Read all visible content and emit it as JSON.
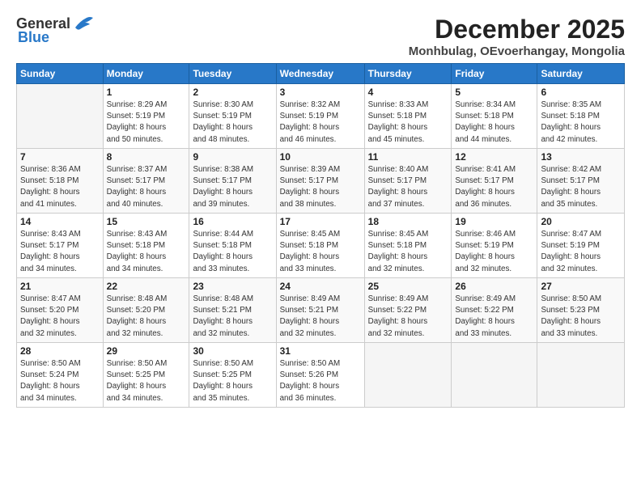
{
  "logo": {
    "general": "General",
    "blue": "Blue"
  },
  "title": {
    "month": "December 2025",
    "location": "Monhbulag, OEvoerhangay, Mongolia"
  },
  "header_days": [
    "Sunday",
    "Monday",
    "Tuesday",
    "Wednesday",
    "Thursday",
    "Friday",
    "Saturday"
  ],
  "weeks": [
    [
      {
        "day": "",
        "info": ""
      },
      {
        "day": "1",
        "info": "Sunrise: 8:29 AM\nSunset: 5:19 PM\nDaylight: 8 hours\nand 50 minutes."
      },
      {
        "day": "2",
        "info": "Sunrise: 8:30 AM\nSunset: 5:19 PM\nDaylight: 8 hours\nand 48 minutes."
      },
      {
        "day": "3",
        "info": "Sunrise: 8:32 AM\nSunset: 5:19 PM\nDaylight: 8 hours\nand 46 minutes."
      },
      {
        "day": "4",
        "info": "Sunrise: 8:33 AM\nSunset: 5:18 PM\nDaylight: 8 hours\nand 45 minutes."
      },
      {
        "day": "5",
        "info": "Sunrise: 8:34 AM\nSunset: 5:18 PM\nDaylight: 8 hours\nand 44 minutes."
      },
      {
        "day": "6",
        "info": "Sunrise: 8:35 AM\nSunset: 5:18 PM\nDaylight: 8 hours\nand 42 minutes."
      }
    ],
    [
      {
        "day": "7",
        "info": "Sunrise: 8:36 AM\nSunset: 5:18 PM\nDaylight: 8 hours\nand 41 minutes."
      },
      {
        "day": "8",
        "info": "Sunrise: 8:37 AM\nSunset: 5:17 PM\nDaylight: 8 hours\nand 40 minutes."
      },
      {
        "day": "9",
        "info": "Sunrise: 8:38 AM\nSunset: 5:17 PM\nDaylight: 8 hours\nand 39 minutes."
      },
      {
        "day": "10",
        "info": "Sunrise: 8:39 AM\nSunset: 5:17 PM\nDaylight: 8 hours\nand 38 minutes."
      },
      {
        "day": "11",
        "info": "Sunrise: 8:40 AM\nSunset: 5:17 PM\nDaylight: 8 hours\nand 37 minutes."
      },
      {
        "day": "12",
        "info": "Sunrise: 8:41 AM\nSunset: 5:17 PM\nDaylight: 8 hours\nand 36 minutes."
      },
      {
        "day": "13",
        "info": "Sunrise: 8:42 AM\nSunset: 5:17 PM\nDaylight: 8 hours\nand 35 minutes."
      }
    ],
    [
      {
        "day": "14",
        "info": "Sunrise: 8:43 AM\nSunset: 5:17 PM\nDaylight: 8 hours\nand 34 minutes."
      },
      {
        "day": "15",
        "info": "Sunrise: 8:43 AM\nSunset: 5:18 PM\nDaylight: 8 hours\nand 34 minutes."
      },
      {
        "day": "16",
        "info": "Sunrise: 8:44 AM\nSunset: 5:18 PM\nDaylight: 8 hours\nand 33 minutes."
      },
      {
        "day": "17",
        "info": "Sunrise: 8:45 AM\nSunset: 5:18 PM\nDaylight: 8 hours\nand 33 minutes."
      },
      {
        "day": "18",
        "info": "Sunrise: 8:45 AM\nSunset: 5:18 PM\nDaylight: 8 hours\nand 32 minutes."
      },
      {
        "day": "19",
        "info": "Sunrise: 8:46 AM\nSunset: 5:19 PM\nDaylight: 8 hours\nand 32 minutes."
      },
      {
        "day": "20",
        "info": "Sunrise: 8:47 AM\nSunset: 5:19 PM\nDaylight: 8 hours\nand 32 minutes."
      }
    ],
    [
      {
        "day": "21",
        "info": "Sunrise: 8:47 AM\nSunset: 5:20 PM\nDaylight: 8 hours\nand 32 minutes."
      },
      {
        "day": "22",
        "info": "Sunrise: 8:48 AM\nSunset: 5:20 PM\nDaylight: 8 hours\nand 32 minutes."
      },
      {
        "day": "23",
        "info": "Sunrise: 8:48 AM\nSunset: 5:21 PM\nDaylight: 8 hours\nand 32 minutes."
      },
      {
        "day": "24",
        "info": "Sunrise: 8:49 AM\nSunset: 5:21 PM\nDaylight: 8 hours\nand 32 minutes."
      },
      {
        "day": "25",
        "info": "Sunrise: 8:49 AM\nSunset: 5:22 PM\nDaylight: 8 hours\nand 32 minutes."
      },
      {
        "day": "26",
        "info": "Sunrise: 8:49 AM\nSunset: 5:22 PM\nDaylight: 8 hours\nand 33 minutes."
      },
      {
        "day": "27",
        "info": "Sunrise: 8:50 AM\nSunset: 5:23 PM\nDaylight: 8 hours\nand 33 minutes."
      }
    ],
    [
      {
        "day": "28",
        "info": "Sunrise: 8:50 AM\nSunset: 5:24 PM\nDaylight: 8 hours\nand 34 minutes."
      },
      {
        "day": "29",
        "info": "Sunrise: 8:50 AM\nSunset: 5:25 PM\nDaylight: 8 hours\nand 34 minutes."
      },
      {
        "day": "30",
        "info": "Sunrise: 8:50 AM\nSunset: 5:25 PM\nDaylight: 8 hours\nand 35 minutes."
      },
      {
        "day": "31",
        "info": "Sunrise: 8:50 AM\nSunset: 5:26 PM\nDaylight: 8 hours\nand 36 minutes."
      },
      {
        "day": "",
        "info": ""
      },
      {
        "day": "",
        "info": ""
      },
      {
        "day": "",
        "info": ""
      }
    ]
  ]
}
